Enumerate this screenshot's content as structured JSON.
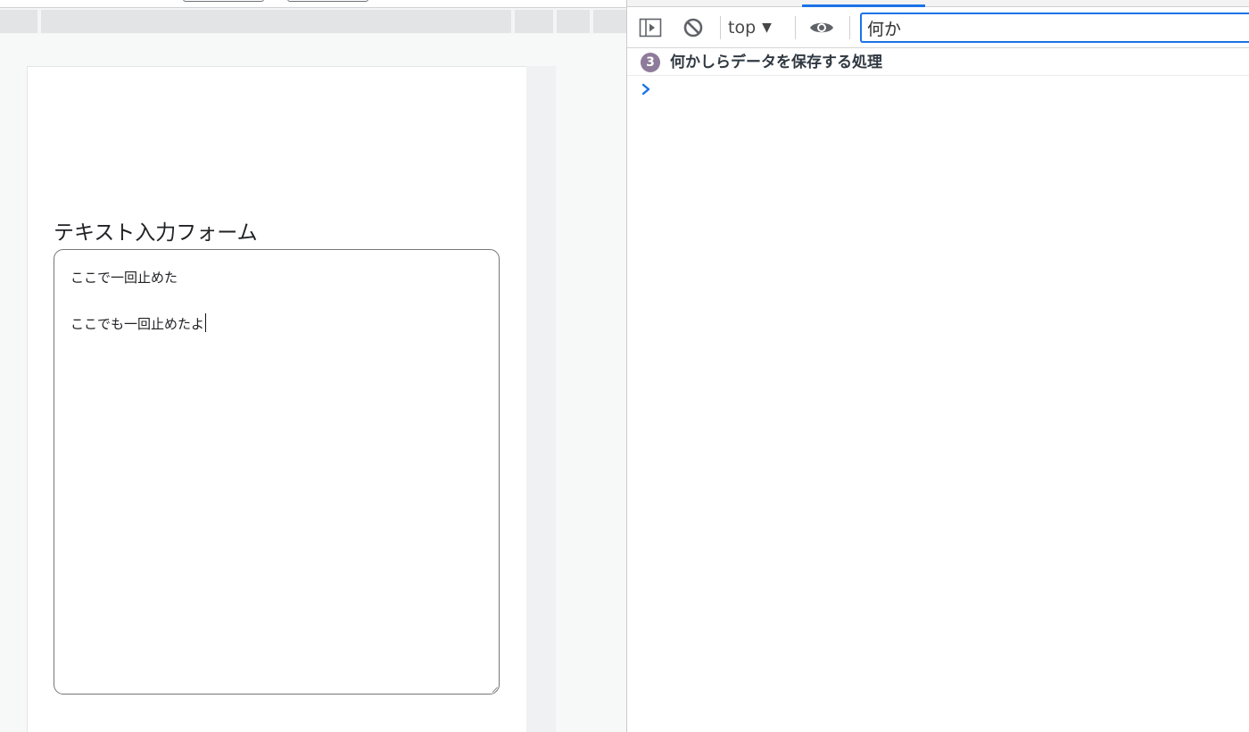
{
  "page": {
    "form_title": "テキスト入力フォーム",
    "textarea": {
      "lines": [
        "ここで一回止めた",
        "ここでも一回止めたよ"
      ]
    }
  },
  "devtools": {
    "context": {
      "value": "top",
      "arrow": "▼"
    },
    "filter": {
      "value": "何か"
    },
    "log": {
      "count": "3",
      "message": "何かしらデータを保存する処理"
    },
    "icons": {
      "sidebar": "sidebar-toggle-icon",
      "clear": "clear-console-icon",
      "live_expression": "eye-icon",
      "prompt": "chevron-right-icon"
    },
    "colors": {
      "accent": "#1a73e8",
      "badge": "#8e7b9a"
    }
  }
}
